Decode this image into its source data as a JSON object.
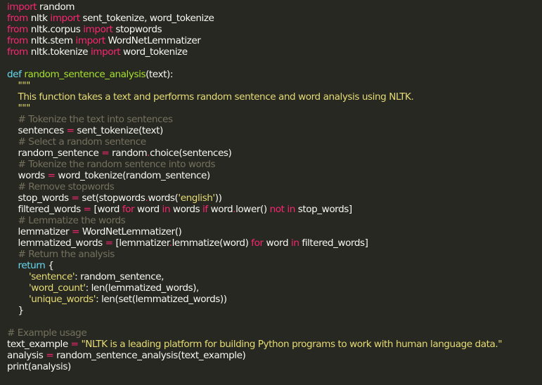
{
  "colors": {
    "background": "#272822",
    "text": "#f8f8f2",
    "keyword": "#f92672",
    "def": "#66d9ef",
    "function": "#a6e22e",
    "string": "#e6db74",
    "comment": "#75715e"
  },
  "code_lines": [
    [
      [
        "keyword",
        "import"
      ],
      [
        "text",
        " random"
      ]
    ],
    [
      [
        "keyword",
        "from"
      ],
      [
        "text",
        " nltk "
      ],
      [
        "keyword",
        "import"
      ],
      [
        "text",
        " sent_tokenize, word_tokenize"
      ]
    ],
    [
      [
        "keyword",
        "from"
      ],
      [
        "text",
        " nltk.corpus "
      ],
      [
        "keyword",
        "import"
      ],
      [
        "text",
        " stopwords"
      ]
    ],
    [
      [
        "keyword",
        "from"
      ],
      [
        "text",
        " nltk.stem "
      ],
      [
        "keyword",
        "import"
      ],
      [
        "text",
        " WordNetLemmatizer"
      ]
    ],
    [
      [
        "keyword",
        "from"
      ],
      [
        "text",
        " nltk.tokenize "
      ],
      [
        "keyword",
        "import"
      ],
      [
        "text",
        " word_tokenize"
      ]
    ],
    [],
    [
      [
        "def",
        "def"
      ],
      [
        "text",
        " "
      ],
      [
        "func",
        "random_sentence_analysis"
      ],
      [
        "text",
        "(text):"
      ]
    ],
    [
      [
        "string",
        "    \"\"\""
      ]
    ],
    [
      [
        "string",
        "    This function takes a text and performs random sentence and word analysis using NLTK."
      ]
    ],
    [
      [
        "string",
        "    \"\"\""
      ]
    ],
    [
      [
        "comment",
        "    # Tokenize the text into sentences"
      ]
    ],
    [
      [
        "text",
        "    sentences "
      ],
      [
        "keyword",
        "="
      ],
      [
        "text",
        " sent_tokenize(text)"
      ]
    ],
    [
      [
        "comment",
        "    # Select a random sentence"
      ]
    ],
    [
      [
        "text",
        "    random_sentence "
      ],
      [
        "keyword",
        "="
      ],
      [
        "text",
        " random"
      ],
      [
        "keyword",
        "."
      ],
      [
        "text",
        "choice(sentences)"
      ]
    ],
    [
      [
        "comment",
        "    # Tokenize the random sentence into words"
      ]
    ],
    [
      [
        "text",
        "    words "
      ],
      [
        "keyword",
        "="
      ],
      [
        "text",
        " word_tokenize(random_sentence)"
      ]
    ],
    [
      [
        "comment",
        "    # Remove stopwords"
      ]
    ],
    [
      [
        "text",
        "    stop_words "
      ],
      [
        "keyword",
        "="
      ],
      [
        "text",
        " set(stopwords"
      ],
      [
        "keyword",
        "."
      ],
      [
        "text",
        "words("
      ],
      [
        "string",
        "'english'"
      ],
      [
        "text",
        "))"
      ]
    ],
    [
      [
        "text",
        "    filtered_words "
      ],
      [
        "keyword",
        "="
      ],
      [
        "text",
        " [word "
      ],
      [
        "keyword",
        "for"
      ],
      [
        "text",
        " word "
      ],
      [
        "keyword",
        "in"
      ],
      [
        "text",
        " words "
      ],
      [
        "keyword",
        "if"
      ],
      [
        "text",
        " word"
      ],
      [
        "keyword",
        "."
      ],
      [
        "text",
        "lower() "
      ],
      [
        "keyword",
        "not in"
      ],
      [
        "text",
        " stop_words]"
      ]
    ],
    [
      [
        "comment",
        "    # Lemmatize the words"
      ]
    ],
    [
      [
        "text",
        "    lemmatizer "
      ],
      [
        "keyword",
        "="
      ],
      [
        "text",
        " WordNetLemmatizer()"
      ]
    ],
    [
      [
        "text",
        "    lemmatized_words "
      ],
      [
        "keyword",
        "="
      ],
      [
        "text",
        " [lemmatizer"
      ],
      [
        "keyword",
        "."
      ],
      [
        "text",
        "lemmatize(word) "
      ],
      [
        "keyword",
        "for"
      ],
      [
        "text",
        " word "
      ],
      [
        "keyword",
        "in"
      ],
      [
        "text",
        " filtered_words]"
      ]
    ],
    [
      [
        "comment",
        "    # Return the analysis"
      ]
    ],
    [
      [
        "def",
        "    return"
      ],
      [
        "text",
        " {"
      ]
    ],
    [
      [
        "string",
        "        'sentence'"
      ],
      [
        "text",
        ": random_sentence,"
      ]
    ],
    [
      [
        "string",
        "        'word_count'"
      ],
      [
        "text",
        ": len(lemmatized_words),"
      ]
    ],
    [
      [
        "string",
        "        'unique_words'"
      ],
      [
        "text",
        ": len(set(lemmatized_words))"
      ]
    ],
    [
      [
        "text",
        "    }"
      ]
    ],
    [],
    [
      [
        "comment",
        "# Example usage"
      ]
    ],
    [
      [
        "text",
        "text_example "
      ],
      [
        "keyword",
        "="
      ],
      [
        "text",
        " "
      ],
      [
        "string",
        "\"NLTK is a leading platform for building Python programs to work with human language data.\""
      ]
    ],
    [
      [
        "text",
        "analysis "
      ],
      [
        "keyword",
        "="
      ],
      [
        "text",
        " random_sentence_analysis(text_example)"
      ]
    ],
    [
      [
        "text",
        "print(analysis)"
      ]
    ]
  ]
}
